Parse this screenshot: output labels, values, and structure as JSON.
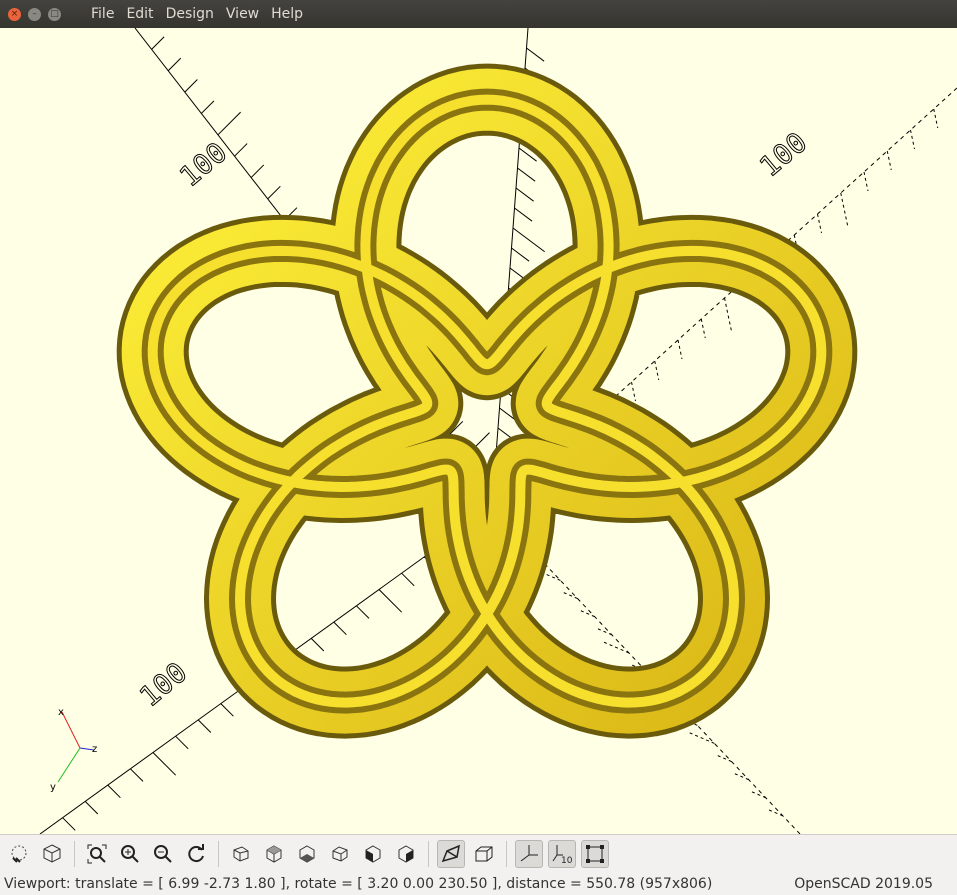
{
  "window": {
    "close_glyph": "×",
    "minimize_glyph": "–",
    "maximize_glyph": "□"
  },
  "menu": [
    "File",
    "Edit",
    "Design",
    "View",
    "Help"
  ],
  "viewport": {
    "background_color": "#ffffe5",
    "model_color": "#f0d62a",
    "model_shadow_color": "#5e4f0a",
    "axis_labels": {
      "x": "x",
      "y": "y",
      "z": "z"
    },
    "scale_marks": [
      "100",
      "100",
      "100"
    ]
  },
  "toolbar": {
    "buttons": [
      {
        "name": "preview-button",
        "icon": "preview-icon"
      },
      {
        "name": "render-button",
        "icon": "render-icon"
      },
      {
        "name": "view-all-button",
        "icon": "view-all-icon"
      },
      {
        "name": "zoom-in-button",
        "icon": "zoom-in-icon"
      },
      {
        "name": "zoom-out-button",
        "icon": "zoom-out-icon"
      },
      {
        "name": "reset-view-button",
        "icon": "reset-view-icon"
      },
      {
        "name": "view-right-button",
        "icon": "view-right-icon"
      },
      {
        "name": "view-top-button",
        "icon": "view-top-icon"
      },
      {
        "name": "view-bottom-button",
        "icon": "view-bottom-icon"
      },
      {
        "name": "view-left-button",
        "icon": "view-left-icon"
      },
      {
        "name": "view-front-button",
        "icon": "view-front-icon"
      },
      {
        "name": "view-back-button",
        "icon": "view-back-icon"
      },
      {
        "name": "perspective-button",
        "icon": "perspective-icon"
      },
      {
        "name": "orthogonal-button",
        "icon": "orthogonal-icon"
      },
      {
        "name": "show-axes-button",
        "icon": "axes-icon"
      },
      {
        "name": "show-scale-markers-button",
        "icon": "scale-markers-icon"
      },
      {
        "name": "show-edges-button",
        "icon": "edges-icon"
      }
    ],
    "scale_icon_text": "10"
  },
  "status": {
    "viewport_info": "Viewport: translate = [ 6.99 -2.73 1.80 ], rotate = [ 3.20 0.00 230.50 ], distance = 550.78 (957x806)",
    "app_version": "OpenSCAD 2019.05"
  }
}
